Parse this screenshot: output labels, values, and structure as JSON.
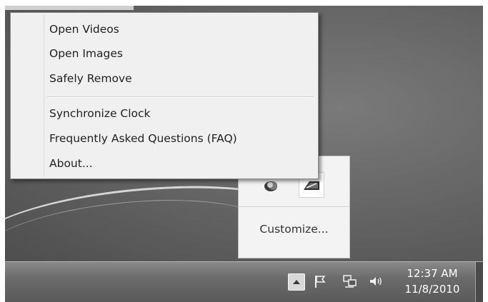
{
  "context_menu": {
    "items": [
      "Open Videos",
      "Open Images",
      "Safely Remove",
      "Synchronize Clock",
      "Frequently Asked Questions (FAQ)",
      "About..."
    ]
  },
  "tray_popup": {
    "icons": [
      "app-tray-icon",
      "usb-device-icon"
    ],
    "customize_label": "Customize..."
  },
  "taskbar": {
    "tray_icons": [
      "show-hidden-icons-arrow-icon",
      "action-center-flag-icon",
      "network-icon",
      "volume-icon"
    ],
    "clock_time": "12:37 AM",
    "clock_date": "11/8/2010"
  }
}
